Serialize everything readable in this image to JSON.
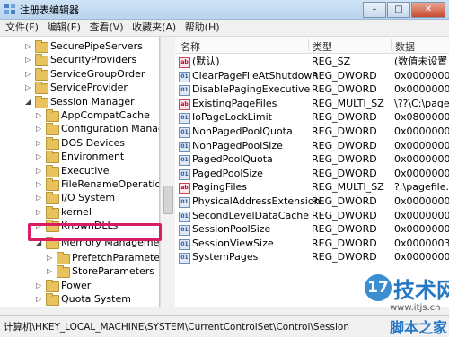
{
  "window": {
    "title": "注册表编辑器",
    "buttons": {
      "minimize": "–",
      "maximize": "□",
      "close": "✕"
    }
  },
  "menu": [
    "文件(F)",
    "编辑(E)",
    "查看(V)",
    "收藏夹(A)",
    "帮助(H)"
  ],
  "tree": {
    "items": [
      {
        "label": "SecurePipeServers",
        "expanded": false
      },
      {
        "label": "SecurityProviders",
        "expanded": false
      },
      {
        "label": "ServiceGroupOrder",
        "expanded": false
      },
      {
        "label": "ServiceProvider",
        "expanded": false
      },
      {
        "label": "Session Manager",
        "expanded": true
      },
      {
        "label": "AppCompatCache",
        "expanded": false
      },
      {
        "label": "Configuration Manager",
        "expanded": false
      },
      {
        "label": "DOS Devices",
        "expanded": false
      },
      {
        "label": "Environment",
        "expanded": false
      },
      {
        "label": "Executive",
        "expanded": false
      },
      {
        "label": "FileRenameOperations",
        "expanded": false
      },
      {
        "label": "I/O System",
        "expanded": false
      },
      {
        "label": "kernel",
        "expanded": false
      },
      {
        "label": "KnownDLLs",
        "expanded": false
      },
      {
        "label": "Memory Management",
        "expanded": true,
        "selected": true
      },
      {
        "label": "PrefetchParameters",
        "expanded": false
      },
      {
        "label": "StoreParameters",
        "expanded": false
      },
      {
        "label": "Power",
        "expanded": false
      },
      {
        "label": "Quota System",
        "expanded": false
      },
      {
        "label": "SubSystems",
        "expanded": false
      }
    ]
  },
  "list": {
    "headers": {
      "name": "名称",
      "type": "类型",
      "data": "数据"
    },
    "rows": [
      {
        "name": "(默认)",
        "type": "REG_SZ",
        "data": "(数值未设置",
        "icon": "string-value-icon"
      },
      {
        "name": "ClearPageFileAtShutdown",
        "type": "REG_DWORD",
        "data": "0x0000000",
        "icon": "binary-value-icon"
      },
      {
        "name": "DisablePagingExecutive",
        "type": "REG_DWORD",
        "data": "0x0000000",
        "icon": "binary-value-icon"
      },
      {
        "name": "ExistingPageFiles",
        "type": "REG_MULTI_SZ",
        "data": "\\??\\C:\\page",
        "icon": "string-value-icon"
      },
      {
        "name": "IoPageLockLimit",
        "type": "REG_DWORD",
        "data": "0x0800000",
        "icon": "binary-value-icon"
      },
      {
        "name": "NonPagedPoolQuota",
        "type": "REG_DWORD",
        "data": "0x0000000",
        "icon": "binary-value-icon"
      },
      {
        "name": "NonPagedPoolSize",
        "type": "REG_DWORD",
        "data": "0x0000000",
        "icon": "binary-value-icon"
      },
      {
        "name": "PagedPoolQuota",
        "type": "REG_DWORD",
        "data": "0x0000000",
        "icon": "binary-value-icon"
      },
      {
        "name": "PagedPoolSize",
        "type": "REG_DWORD",
        "data": "0x0000000",
        "icon": "binary-value-icon"
      },
      {
        "name": "PagingFiles",
        "type": "REG_MULTI_SZ",
        "data": "?:\\pagefile.",
        "icon": "string-value-icon"
      },
      {
        "name": "PhysicalAddressExtension",
        "type": "REG_DWORD",
        "data": "0x0000000",
        "icon": "binary-value-icon"
      },
      {
        "name": "SecondLevelDataCache",
        "type": "REG_DWORD",
        "data": "0x0000000",
        "icon": "binary-value-icon"
      },
      {
        "name": "SessionPoolSize",
        "type": "REG_DWORD",
        "data": "0x0000000",
        "icon": "binary-value-icon"
      },
      {
        "name": "SessionViewSize",
        "type": "REG_DWORD",
        "data": "0x0000003",
        "icon": "binary-value-icon"
      },
      {
        "name": "SystemPages",
        "type": "REG_DWORD",
        "data": "0x0000000",
        "icon": "binary-value-icon"
      }
    ]
  },
  "status": "计算机\\HKEY_LOCAL_MACHINE\\SYSTEM\\CurrentControlSet\\Control\\Session",
  "watermark": {
    "badge": "17",
    "line1": "技术网",
    "line2": "www.itjs.cn",
    "line3": "脚本之家"
  }
}
